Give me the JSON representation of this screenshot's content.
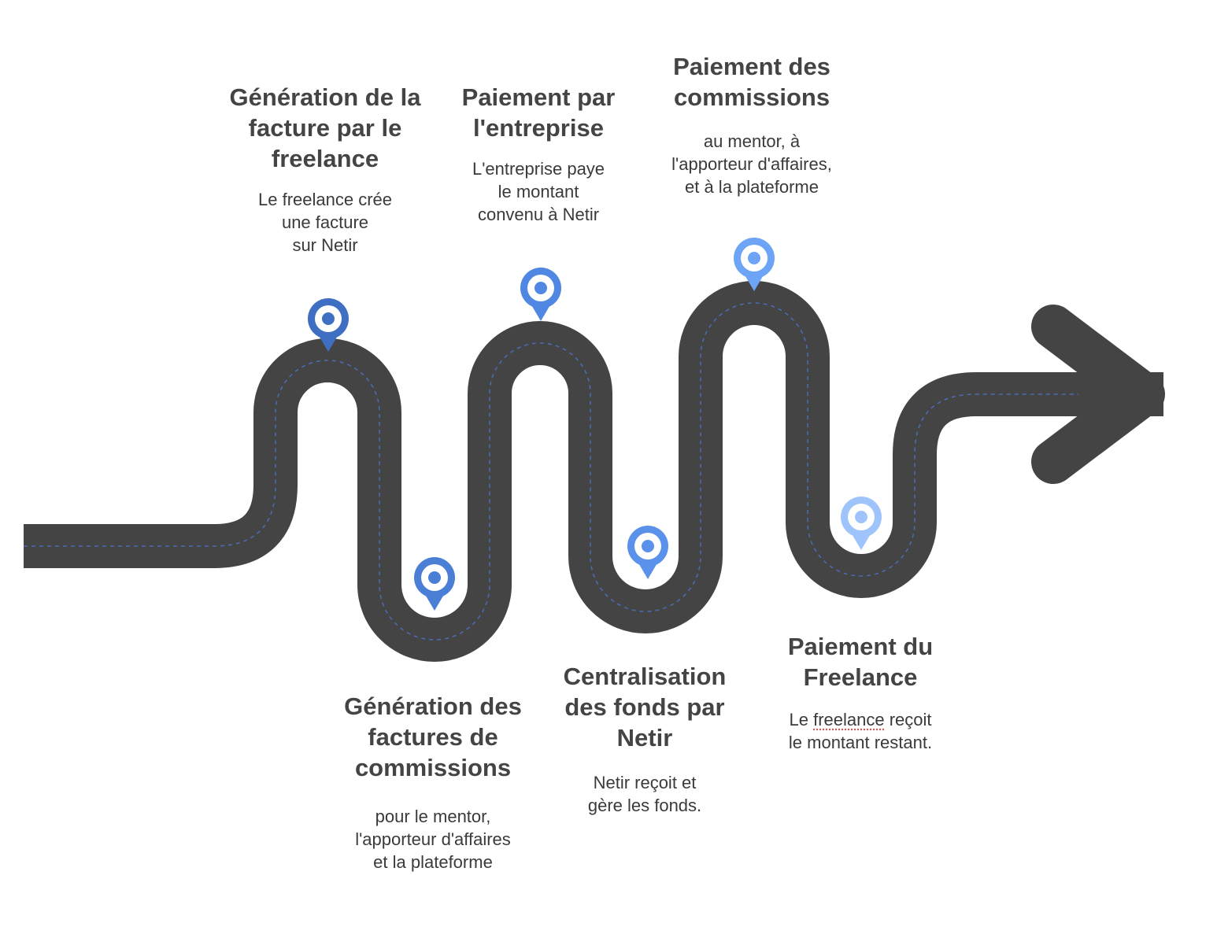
{
  "colors": {
    "road": "#444444",
    "dash": "#4a6db5",
    "pin_1": "#3f6fc2",
    "pin_2": "#4b7fd6",
    "pin_3": "#4f87e3",
    "pin_4": "#5a91ea",
    "pin_5": "#6ea4f5",
    "pin_6": "#9fc4fb",
    "text": "#444444"
  },
  "steps": [
    {
      "title": "Génération de la\nfacture par le\nfreelance",
      "desc": "Le freelance crée\nune facture\nsur Netir"
    },
    {
      "title": "Génération des\nfactures de\ncommissions",
      "desc": "pour le mentor,\nl'apporteur d'affaires\net la plateforme"
    },
    {
      "title": "Paiement par\nl'entreprise",
      "desc": "L'entreprise paye\nle montant\nconvenu à Netir"
    },
    {
      "title": "Centralisation\ndes fonds par\nNetir",
      "desc": "Netir reçoit et\ngère les fonds."
    },
    {
      "title": "Paiement des\ncommissions",
      "desc": "au mentor, à\nl'apporteur d'affaires,\net à la plateforme"
    },
    {
      "title": "Paiement du\nFreelance",
      "desc_line1_pre": "Le ",
      "desc_line1_word": "freelance",
      "desc_line1_post": " reçoit",
      "desc_line2": "le montant restant."
    }
  ],
  "pins": [
    {
      "name": "pin-step-1",
      "color_key": "pin_1"
    },
    {
      "name": "pin-step-2",
      "color_key": "pin_2"
    },
    {
      "name": "pin-step-3",
      "color_key": "pin_3"
    },
    {
      "name": "pin-step-4",
      "color_key": "pin_4"
    },
    {
      "name": "pin-step-5",
      "color_key": "pin_5"
    },
    {
      "name": "pin-step-6",
      "color_key": "pin_6"
    }
  ]
}
